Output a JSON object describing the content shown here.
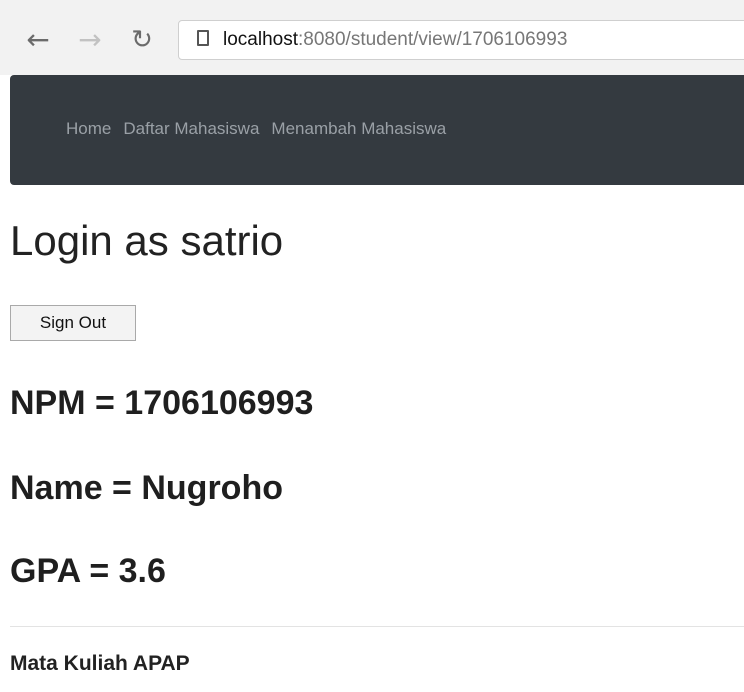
{
  "browser": {
    "back_icon": "arrow-left-icon",
    "forward_icon": "arrow-right-icon",
    "reload_icon": "reload-icon",
    "url_host": "localhost",
    "url_rest": ":8080/student/view/1706106993"
  },
  "navbar": {
    "links": [
      "Home",
      "Daftar Mahasiswa",
      "Menambah Mahasiswa"
    ]
  },
  "main": {
    "title": "Login as satrio",
    "signout_label": "Sign Out",
    "npm": "NPM = 1706106993",
    "name": "Name = Nugroho",
    "gpa": "GPA = 3.6",
    "section_heading": "Mata Kuliah APAP"
  },
  "colors": {
    "navbar_bg": "#343a40",
    "nav_link": "#9aa0a6"
  }
}
